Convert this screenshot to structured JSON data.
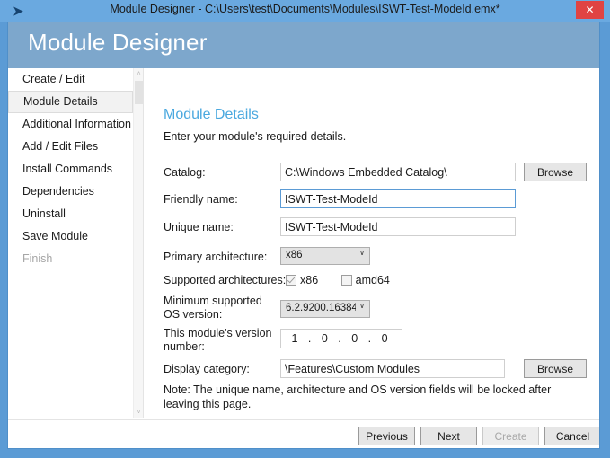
{
  "window": {
    "title": "Module Designer - C:\\Users\\test\\Documents\\Modules\\ISWT-Test-ModeId.emx*",
    "icon": "app-arrow-icon",
    "close_label": "✕",
    "banner_title": "Module Designer",
    "accent_color": "#5b9bd5",
    "banner_color": "#7da7cc",
    "close_color": "#e04343"
  },
  "sidebar": {
    "items": [
      {
        "label": "Create / Edit",
        "state": "normal"
      },
      {
        "label": "Module Details",
        "state": "selected"
      },
      {
        "label": "Additional Information",
        "state": "normal"
      },
      {
        "label": "Add / Edit Files",
        "state": "normal"
      },
      {
        "label": "Install Commands",
        "state": "normal"
      },
      {
        "label": "Dependencies",
        "state": "normal"
      },
      {
        "label": "Uninstall",
        "state": "normal"
      },
      {
        "label": "Save Module",
        "state": "normal"
      },
      {
        "label": "Finish",
        "state": "disabled"
      }
    ],
    "scrollbar": {
      "up_arrow": "˄",
      "down_arrow": "˅"
    }
  },
  "main": {
    "heading": "Module Details",
    "subheading": "Enter your module's required details.",
    "fields": {
      "catalog": {
        "label": "Catalog:",
        "value": "C:\\Windows Embedded Catalog\\",
        "browse_label": "Browse"
      },
      "friendly_name": {
        "label": "Friendly name:",
        "value": "ISWT-Test-ModeId"
      },
      "unique_name": {
        "label": "Unique name:",
        "value": "ISWT-Test-ModeId"
      },
      "primary_architecture": {
        "label": "Primary architecture:",
        "value": "x86",
        "arrow": "∨"
      },
      "supported_architectures": {
        "label": "Supported architectures:",
        "options": [
          {
            "label": "x86",
            "checked": true
          },
          {
            "label": "amd64",
            "checked": false
          }
        ]
      },
      "min_os_version": {
        "label": "Minimum supported\nOS version:",
        "value": "6.2.9200.16384",
        "arrow": "∨"
      },
      "module_version": {
        "label": "This module's version\nnumber:",
        "value": "1 . 0 . 0 . 0"
      },
      "display_category": {
        "label": "Display category:",
        "value": "\\Features\\Custom Modules",
        "browse_label": "Browse"
      }
    },
    "note": "Note: The unique name, architecture and OS version fields will be locked after leaving this page."
  },
  "footer": {
    "buttons": [
      {
        "label": "Previous",
        "disabled": false
      },
      {
        "label": "Next",
        "disabled": false
      },
      {
        "label": "Create",
        "disabled": true
      },
      {
        "label": "Cancel",
        "disabled": false
      }
    ]
  }
}
